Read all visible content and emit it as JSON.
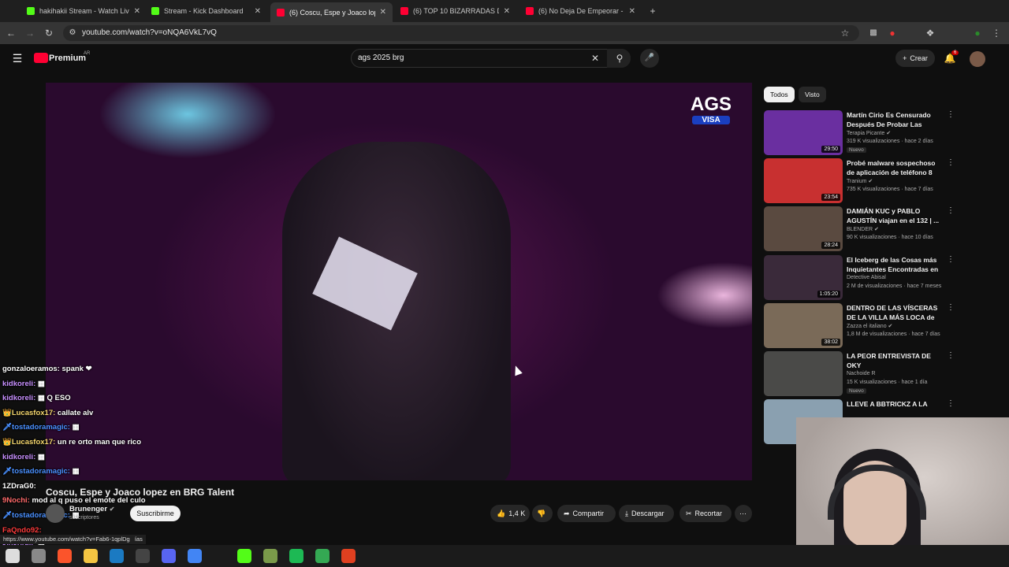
{
  "browser": {
    "tabs": [
      {
        "title": "hakihakii Stream - Watch Live o",
        "color": "#53fc18",
        "active": false
      },
      {
        "title": "Stream - Kick Dashboard",
        "color": "#53fc18",
        "active": false
      },
      {
        "title": "(6) Coscu, Espe y Joaco lop",
        "color": "#ff0033",
        "active": true
      },
      {
        "title": "(6) TOP 10 BIZARRADAS DE SA",
        "color": "#ff0033",
        "active": false
      },
      {
        "title": "(6) No Deja De Empeorar - You",
        "color": "#ff0033",
        "active": false
      }
    ],
    "url": "youtube.com/watch?v=oNQA6VkL7vQ",
    "status_url": "https://www.youtube.com/watch?v=Fab6-1qplDg"
  },
  "youtube": {
    "logo": "Premium",
    "logo_sup": "AR",
    "search_value": "ags 2025 brg",
    "create_label": "Crear",
    "notif_count": "6"
  },
  "video": {
    "logo_text": "AGS",
    "logo_sub": "VISA",
    "title": "Coscu, Espe y Joaco lopez en BRG Talent",
    "channel": "Brunenger",
    "subs": "suscriptores",
    "subscribe_label": "Suscribirme",
    "likes": "1,4 K",
    "share_label": "Compartir",
    "download_label": "Descargar",
    "clip_label": "Recortar",
    "partial_text": "ías"
  },
  "chat": [
    {
      "user": "gonzaloeramos:",
      "msg": "spank ❤",
      "color": "#ffffff"
    },
    {
      "user": "kidkoreli:",
      "msg": "▦",
      "color": "#c890ff"
    },
    {
      "user": "kidkoreli:",
      "msg": "▦ Q ESO",
      "color": "#c890ff"
    },
    {
      "user": "👑Lucasfox17:",
      "msg": "callate alv",
      "color": "#f5d76e"
    },
    {
      "user": "🗡tostadoramagic:",
      "msg": "▦",
      "color": "#4a90ff"
    },
    {
      "user": "👑Lucasfox17:",
      "msg": "un re orto man que rico",
      "color": "#f5d76e"
    },
    {
      "user": "kidkoreli:",
      "msg": "▦",
      "color": "#c890ff"
    },
    {
      "user": "🗡tostadoramagic:",
      "msg": "▦",
      "color": "#4a90ff"
    },
    {
      "user": "1ZDraG0:",
      "msg": "",
      "color": "#ffffff"
    },
    {
      "user": "9Nochi:",
      "msg": "mod al q puso el emote del culo",
      "color": "#ff6a6a"
    },
    {
      "user": "🗡tostadoramagic:",
      "msg": "▦",
      "color": "#4a90ff"
    },
    {
      "user": "FaQndo92:",
      "msg": "",
      "color": "#ff3b3b"
    },
    {
      "user": "kidkoreli:",
      "msg": "▦",
      "color": "#c890ff"
    },
    {
      "user": "kidkoreli:",
      "msg": "",
      "color": "#c890ff"
    }
  ],
  "sidebar": {
    "chips": [
      "Todos",
      "Visto"
    ],
    "recs": [
      {
        "title": "Martín Cirio Es Censurado Después De Probar Las Salsas...",
        "channel": "Terapia Picante ✔",
        "meta": "319 K visualizaciones · hace 2 días",
        "duration": "29:50",
        "new": "Nuevo",
        "thumb": "#6a2fa0"
      },
      {
        "title": "Probé malware sospechoso de aplicación de teléfono 8",
        "channel": "Tranium ✔",
        "meta": "735 K visualizaciones · hace 7 días",
        "duration": "23:54",
        "new": "",
        "thumb": "#c83030"
      },
      {
        "title": "DAMIÁN KUC y PABLO AGUSTÍN viajan en el 132 | ...",
        "channel": "BLENDER ✔",
        "meta": "90 K visualizaciones · hace 10 días",
        "duration": "28:24",
        "new": "",
        "thumb": "#5a4a40"
      },
      {
        "title": "El Iceberg de las Cosas más Inquietantes Encontradas en ...",
        "channel": "Detective Abisal",
        "meta": "2 M de visualizaciones · hace 7 meses",
        "duration": "1:05:20",
        "new": "",
        "thumb": "#3a2a3a"
      },
      {
        "title": "DENTRO DE LAS VÍSCERAS DE LA VILLA MÁS LOCA de ...",
        "channel": "Zazza el italiano ✔",
        "meta": "1,8 M de visualizaciones · hace 7 días",
        "duration": "38:02",
        "new": "",
        "thumb": "#7a6a58"
      },
      {
        "title": "LA PEOR ENTREVISTA DE OKY",
        "channel": "Nachoide R",
        "meta": "15 K visualizaciones · hace 1 día",
        "duration": "",
        "new": "Nuevo",
        "thumb": "#4a4a48"
      },
      {
        "title": "LLEVE A BBTRICKZ A LA",
        "channel": "",
        "meta": "",
        "duration": "",
        "new": "",
        "thumb": "#8aa0b0"
      }
    ]
  }
}
